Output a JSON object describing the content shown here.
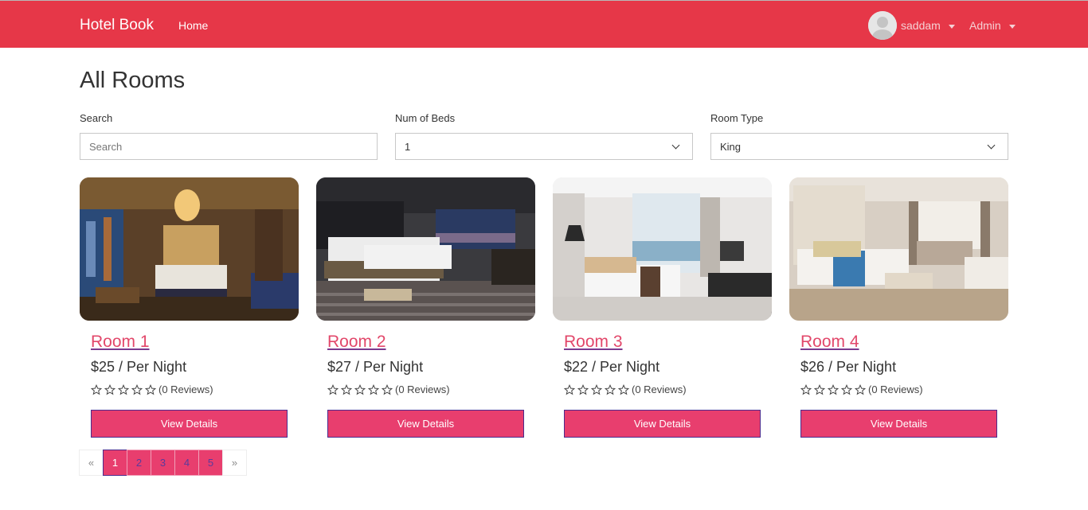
{
  "nav": {
    "brand": "Hotel Book",
    "home": "Home",
    "user": "saddam",
    "admin": "Admin"
  },
  "page": {
    "title": "All Rooms"
  },
  "filters": {
    "search_label": "Search",
    "search_placeholder": "Search",
    "search_value": "",
    "beds_label": "Num of Beds",
    "beds_value": "1",
    "type_label": "Room Type",
    "type_value": "King"
  },
  "rooms": [
    {
      "name": "Room 1",
      "price": "$25 / Per Night",
      "rating": 0,
      "reviews": "(0 Reviews)",
      "button": "View Details"
    },
    {
      "name": "Room 2",
      "price": "$27 / Per Night",
      "rating": 0,
      "reviews": "(0 Reviews)",
      "button": "View Details"
    },
    {
      "name": "Room 3",
      "price": "$22 / Per Night",
      "rating": 0,
      "reviews": "(0 Reviews)",
      "button": "View Details"
    },
    {
      "name": "Room 4",
      "price": "$26 / Per Night",
      "rating": 0,
      "reviews": "(0 Reviews)",
      "button": "View Details"
    }
  ],
  "pagination": {
    "prev": "«",
    "pages": [
      "1",
      "2",
      "3",
      "4",
      "5"
    ],
    "current": "1",
    "next": "»"
  },
  "colors": {
    "navbar": "#e63748",
    "accent": "#e83e6e",
    "link": "#e2476a"
  },
  "icons": {
    "avatar": "user-avatar-icon",
    "dropdown": "caret-down-icon",
    "select": "chevron-down-icon",
    "star": "star-outline-icon"
  }
}
